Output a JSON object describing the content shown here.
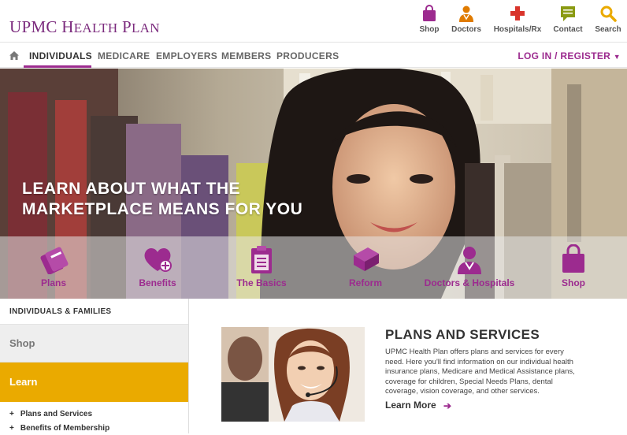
{
  "brand": {
    "name": "UPMC Health Plan",
    "accent": "#9c2b8f",
    "gold": "#eaaa00"
  },
  "utility_nav": [
    {
      "label": "Shop",
      "icon": "shopping-bag-icon"
    },
    {
      "label": "Doctors",
      "icon": "doctor-icon"
    },
    {
      "label": "Hospitals/Rx",
      "icon": "medical-cross-icon"
    },
    {
      "label": "Contact",
      "icon": "chat-icon"
    },
    {
      "label": "Search",
      "icon": "search-icon"
    }
  ],
  "main_nav": {
    "items": [
      "INDIVIDUALS",
      "MEDICARE",
      "EMPLOYERS",
      "MEMBERS",
      "PRODUCERS"
    ],
    "login": "LOG IN / REGISTER"
  },
  "hero": {
    "title_line1": "LEARN ABOUT WHAT THE",
    "title_line2": "MARKETPLACE MEANS FOR YOU"
  },
  "icon_bar": [
    {
      "label": "Plans",
      "icon": "cards-icon"
    },
    {
      "label": "Benefits",
      "icon": "heart-plus-icon"
    },
    {
      "label": "The Basics",
      "icon": "clipboard-icon"
    },
    {
      "label": "Reform",
      "icon": "book-icon"
    },
    {
      "label": "Doctors & Hospitals",
      "icon": "doctor-icon"
    },
    {
      "label": "Shop",
      "icon": "shopping-bag-icon"
    }
  ],
  "sidebar": {
    "heading": "INDIVIDUALS & FAMILIES",
    "shop": "Shop",
    "learn": "Learn",
    "sub_items": [
      "Plans and Services",
      "Benefits of Membership"
    ]
  },
  "content": {
    "title": "PLANS AND SERVICES",
    "body": "UPMC Health Plan offers plans and services for every need. Here you'll find information on our individual health insurance plans, Medicare and Medical Assistance plans, coverage for children, Special Needs Plans, dental coverage, vision coverage, and other services.",
    "cta": "Learn More"
  }
}
